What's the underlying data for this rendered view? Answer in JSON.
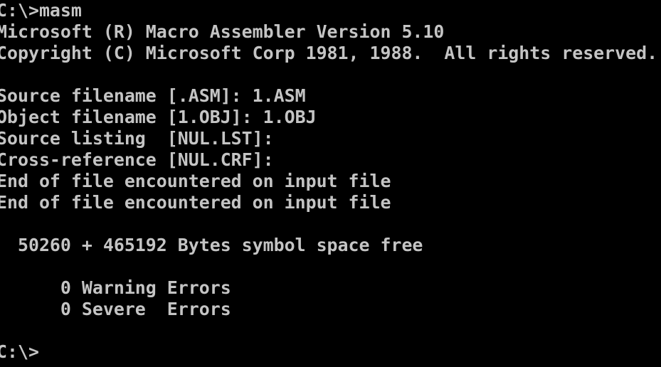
{
  "terminal": {
    "lines": [
      "C:\\>masm",
      "Microsoft (R) Macro Assembler Version 5.10",
      "Copyright (C) Microsoft Corp 1981, 1988.  All rights reserved.",
      "",
      "Source filename [.ASM]: 1.ASM",
      "Object filename [1.OBJ]: 1.OBJ",
      "Source listing  [NUL.LST]:",
      "Cross-reference [NUL.CRF]:",
      "End of file encountered on input file",
      "End of file encountered on input file",
      "",
      "  50260 + 465192 Bytes symbol space free",
      "",
      "      0 Warning Errors",
      "      0 Severe  Errors",
      "",
      "C:\\>"
    ],
    "text_color": "#c4c4c4",
    "background": "#000000"
  }
}
